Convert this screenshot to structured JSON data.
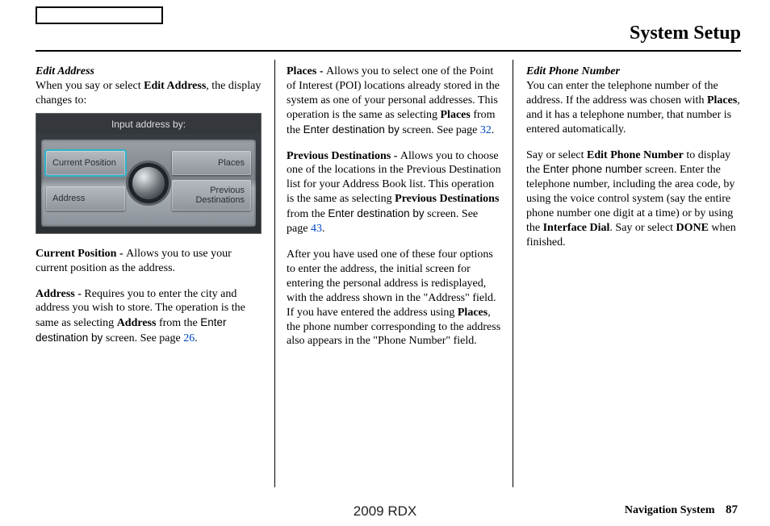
{
  "header": {
    "title": "System Setup"
  },
  "col1": {
    "subhead": "Edit Address",
    "intro_pre": "When you say or select ",
    "intro_bold": "Edit Address",
    "intro_post": ", the display changes to:",
    "screen": {
      "title": "Input address by:",
      "btn_tl": "Current Position",
      "btn_tr": "Places",
      "btn_bl": "Address",
      "btn_br_l1": "Previous",
      "btn_br_l2": "Destinations"
    },
    "p_cp_label": "Current Position - ",
    "p_cp_body": "Allows you to use your current position as the address.",
    "p_addr_label": "Address - ",
    "p_addr_body1": "Requires you to enter the city and address you wish to store. The operation is the same as selecting ",
    "p_addr_bold": "Address",
    "p_addr_body2": " from the ",
    "p_addr_sans": "Enter destination by",
    "p_addr_body3": " screen. See page ",
    "p_addr_page": "26",
    "p_addr_body4": "."
  },
  "col2": {
    "p_places_label": "Places - ",
    "p_places_body1": "Allows you to select one of the Point of Interest (POI) locations already stored in the system as one of your personal addresses. This operation is the same as selecting ",
    "p_places_bold": "Places",
    "p_places_body2": " from the ",
    "p_places_sans": "Enter destination by",
    "p_places_body3": " screen. See page ",
    "p_places_page": "32",
    "p_places_body4": ".",
    "p_prev_label": "Previous Destinations - ",
    "p_prev_body1": "Allows you to choose one of the locations in the Previous Destination list for your Address Book list. This operation is the same as selecting ",
    "p_prev_bold": "Previous Destinations",
    "p_prev_body2": " from the ",
    "p_prev_sans": "Enter destination by",
    "p_prev_body3": " screen. See page ",
    "p_prev_page": "43",
    "p_prev_body4": ".",
    "p_after_body1": "After you have used one of these four options to enter the address, the initial screen for entering the personal address is redisplayed, with the address shown in the \"Address\" field. If you have entered the address using ",
    "p_after_bold": "Places",
    "p_after_body2": ", the phone number corresponding to the address also appears in the \"Phone Number\" field."
  },
  "col3": {
    "subhead": "Edit Phone Number",
    "p1_body1": "You can enter the telephone number of the address. If the address was chosen with ",
    "p1_bold": "Places",
    "p1_body2": ", and it has a telephone number, that number is entered automatically.",
    "p2_body1": "Say or select ",
    "p2_bold1": "Edit Phone Number",
    "p2_body2": " to display the ",
    "p2_sans": "Enter phone number",
    "p2_body3": " screen. Enter the telephone number, including the area code, by using the voice control system (say the entire phone number one digit at a time) or by using the ",
    "p2_bold2": "Interface Dial",
    "p2_body4": ". Say or select ",
    "p2_bold3": "DONE",
    "p2_body5": " when finished."
  },
  "footer": {
    "center": "2009  RDX",
    "label": "Navigation System",
    "page": "87"
  }
}
